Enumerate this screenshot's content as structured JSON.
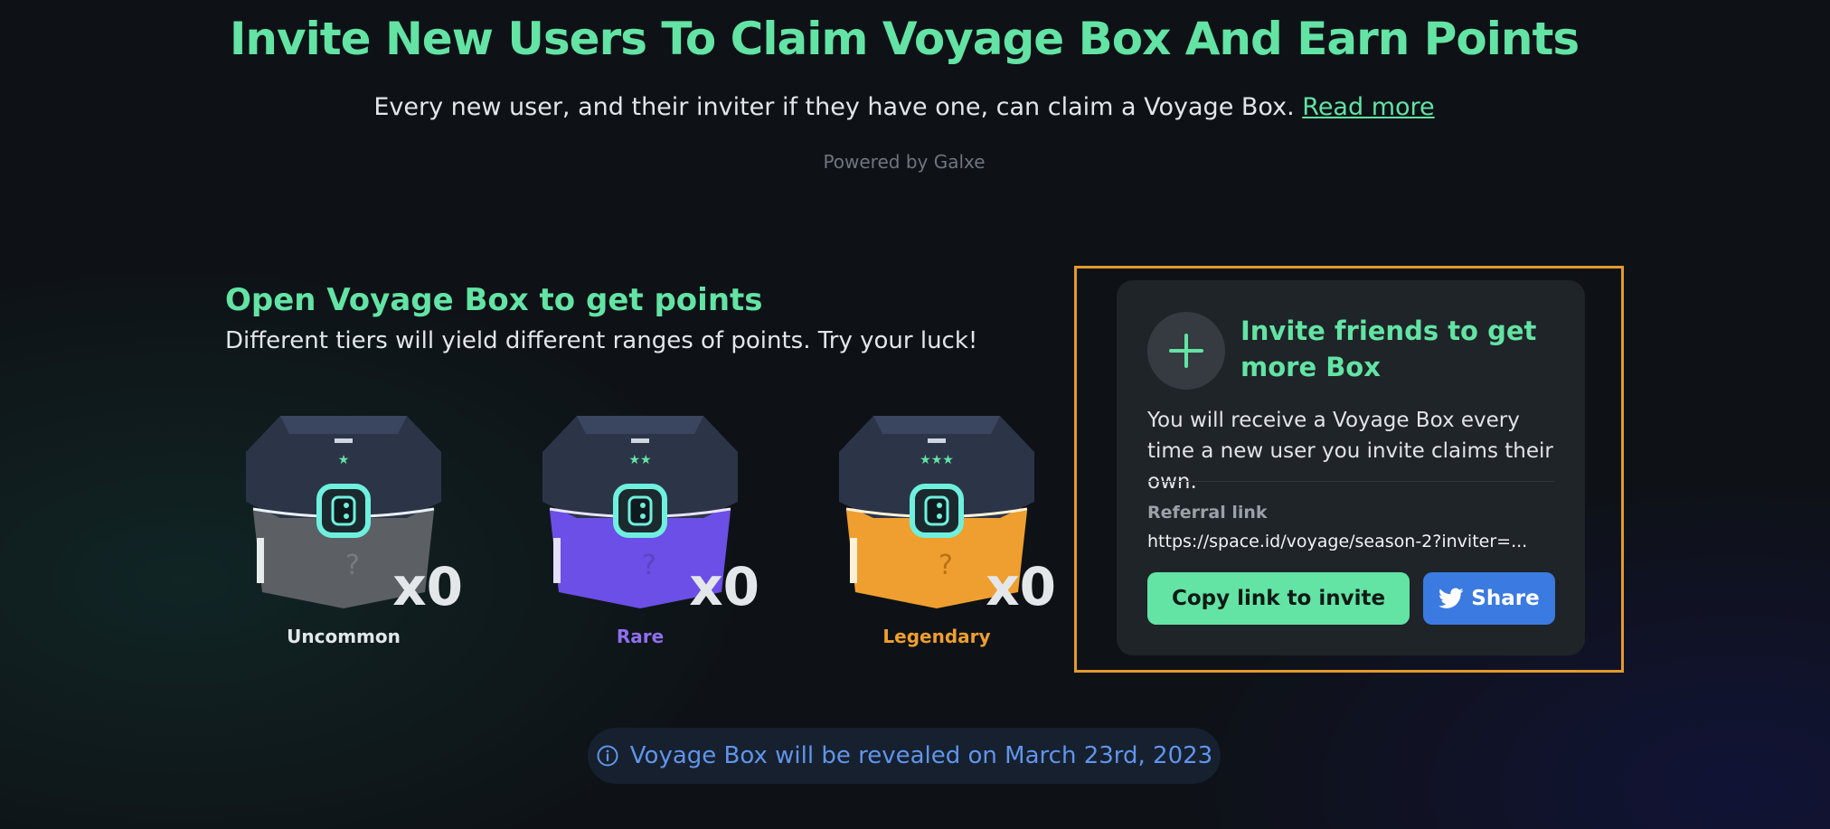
{
  "header": {
    "title": "Invite New Users To Claim Voyage Box And Earn Points",
    "subtitle": "Every new user, and their inviter if they have one, can claim a Voyage Box.",
    "read_more": "Read more",
    "powered_by": "Powered by Galxe"
  },
  "boxes_section": {
    "title": "Open Voyage Box to get points",
    "description": "Different tiers will yield different ranges of points. Try your luck!",
    "boxes": [
      {
        "label": "Uncommon",
        "count": "x0",
        "color": "#e4e7ea",
        "body_color": "#5c6065"
      },
      {
        "label": "Rare",
        "count": "x0",
        "color": "#8f6ff0",
        "body_color": "#6b4fe6"
      },
      {
        "label": "Legendary",
        "count": "x0",
        "color": "#ef9f2f",
        "body_color": "#ef9f2f"
      }
    ]
  },
  "invite_card": {
    "icon": "plus-icon",
    "title": "Invite friends to get more Box",
    "description": "You will receive a Voyage Box every time a new user you invite claims their own.",
    "referral_label": "Referral link",
    "referral_link": "https://space.id/voyage/season-2?inviter=...",
    "copy_button": "Copy link to invite",
    "share_button": "Share",
    "share_icon": "twitter-icon"
  },
  "notice": {
    "icon": "info-icon",
    "text": "Voyage Box will be revealed on March 23rd, 2023"
  },
  "colors": {
    "accent": "#63e3a4",
    "highlight_border": "#e39a2d",
    "share_blue": "#3b7ae0",
    "notice_blue": "#5f95ec"
  }
}
